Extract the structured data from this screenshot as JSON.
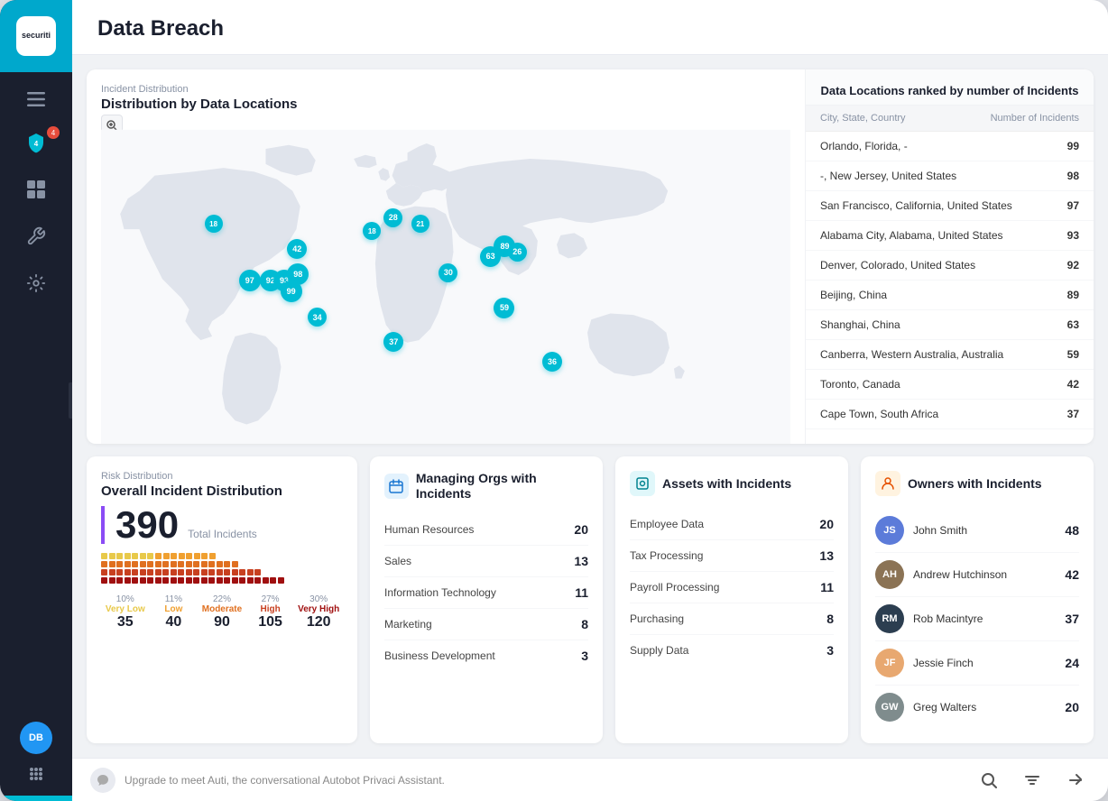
{
  "app": {
    "logo_text": "securiti",
    "page_title": "Data Breach"
  },
  "sidebar": {
    "menu_icon": "☰",
    "icons": [
      {
        "name": "shield-icon",
        "symbol": "🛡",
        "active": true,
        "badge": "4"
      },
      {
        "name": "dashboard-icon",
        "symbol": "⊞",
        "active": false
      },
      {
        "name": "wrench-icon",
        "symbol": "🔧",
        "active": false
      },
      {
        "name": "gear-icon",
        "symbol": "⚙",
        "active": false
      }
    ],
    "user_initials": "DB"
  },
  "map_section": {
    "subtitle": "Incident Distribution",
    "title": "Distribution by Data Locations",
    "dots": [
      {
        "id": "d1",
        "value": 18,
        "left": "15%",
        "top": "28%",
        "size": 20
      },
      {
        "id": "d2",
        "value": 42,
        "left": "27%",
        "top": "35%",
        "size": 22
      },
      {
        "id": "d3",
        "value": 18,
        "left": "38%",
        "top": "30%",
        "size": 20
      },
      {
        "id": "d4",
        "value": 28,
        "left": "41%",
        "top": "26%",
        "size": 21
      },
      {
        "id": "d5",
        "value": 21,
        "left": "45%",
        "top": "28%",
        "size": 20
      },
      {
        "id": "d6",
        "value": 97,
        "left": "20%",
        "top": "44%",
        "size": 24
      },
      {
        "id": "d7",
        "value": 92,
        "left": "23%",
        "top": "44%",
        "size": 24
      },
      {
        "id": "d8",
        "value": 93,
        "left": "25%",
        "top": "44%",
        "size": 24
      },
      {
        "id": "d9",
        "value": 98,
        "left": "27%",
        "top": "42%",
        "size": 24
      },
      {
        "id": "d10",
        "value": 99,
        "left": "26%",
        "top": "47%",
        "size": 24
      },
      {
        "id": "d11",
        "value": 30,
        "left": "49%",
        "top": "42%",
        "size": 21
      },
      {
        "id": "d12",
        "value": 34,
        "left": "30%",
        "top": "55%",
        "size": 21
      },
      {
        "id": "d13",
        "value": 37,
        "left": "41%",
        "top": "62%",
        "size": 22
      },
      {
        "id": "d14",
        "value": 89,
        "left": "57%",
        "top": "34%",
        "size": 24
      },
      {
        "id": "d15",
        "value": 26,
        "left": "59%",
        "top": "36%",
        "size": 21
      },
      {
        "id": "d16",
        "value": 63,
        "left": "55%",
        "top": "37%",
        "size": 23
      },
      {
        "id": "d17",
        "value": 59,
        "left": "57%",
        "top": "52%",
        "size": 23
      },
      {
        "id": "d18",
        "value": 36,
        "left": "64%",
        "top": "68%",
        "size": 22
      }
    ]
  },
  "locations_table": {
    "title": "Data Locations ranked by number of Incidents",
    "col_city": "City, State, Country",
    "col_incidents": "Number of Incidents",
    "rows": [
      {
        "location": "Orlando, Florida, -",
        "count": 99
      },
      {
        "location": "-, New Jersey, United States",
        "count": 98
      },
      {
        "location": "San Francisco, California, United States",
        "count": 97
      },
      {
        "location": "Alabama City, Alabama, United States",
        "count": 93
      },
      {
        "location": "Denver, Colorado, United States",
        "count": 92
      },
      {
        "location": "Beijing, China",
        "count": 89
      },
      {
        "location": "Shanghai, China",
        "count": 63
      },
      {
        "location": "Canberra, Western Australia, Australia",
        "count": 59
      },
      {
        "location": "Toronto, Canada",
        "count": 42
      },
      {
        "location": "Cape Town, South Africa",
        "count": 37
      }
    ]
  },
  "risk_distribution": {
    "subtitle": "Risk Distribution",
    "title": "Overall Incident Distribution",
    "total": 390,
    "total_label": "Total Incidents",
    "levels": [
      {
        "pct": "10%",
        "label": "Very Low",
        "class": "very-low",
        "value": 35,
        "color": "#e8c94a"
      },
      {
        "pct": "11%",
        "label": "Low",
        "class": "low",
        "value": 40,
        "color": "#f0a030"
      },
      {
        "pct": "22%",
        "label": "Moderate",
        "class": "moderate",
        "value": 90,
        "color": "#e07020"
      },
      {
        "pct": "27%",
        "label": "High",
        "class": "high",
        "value": 105,
        "color": "#c84020"
      },
      {
        "pct": "30%",
        "label": "Very High",
        "class": "very-high",
        "value": 120,
        "color": "#a01010"
      }
    ]
  },
  "managing_orgs": {
    "title": "Managing Orgs with Incidents",
    "rows": [
      {
        "label": "Human Resources",
        "value": 20
      },
      {
        "label": "Sales",
        "value": 13
      },
      {
        "label": "Information Technology",
        "value": 11
      },
      {
        "label": "Marketing",
        "value": 8
      },
      {
        "label": "Business Development",
        "value": 3
      }
    ]
  },
  "assets": {
    "title": "Assets with Incidents",
    "rows": [
      {
        "label": "Employee Data",
        "value": 20
      },
      {
        "label": "Tax Processing",
        "value": 13
      },
      {
        "label": "Payroll Processing",
        "value": 11
      },
      {
        "label": "Purchasing",
        "value": 8
      },
      {
        "label": "Supply Data",
        "value": 3
      }
    ]
  },
  "owners": {
    "title": "Owners with Incidents",
    "rows": [
      {
        "name": "John Smith",
        "count": 48,
        "color": "#5c7bd9"
      },
      {
        "name": "Andrew Hutchinson",
        "count": 42,
        "color": "#8b7355"
      },
      {
        "name": "Rob Macintyre",
        "count": 37,
        "color": "#2c3e50"
      },
      {
        "name": "Jessie Finch",
        "count": 24,
        "color": "#e8a870"
      },
      {
        "name": "Greg Walters",
        "count": 20,
        "color": "#7f8c8d"
      }
    ]
  },
  "bottom_bar": {
    "chat_text": "Upgrade to meet Auti, the conversational Autobot Privaci Assistant."
  }
}
